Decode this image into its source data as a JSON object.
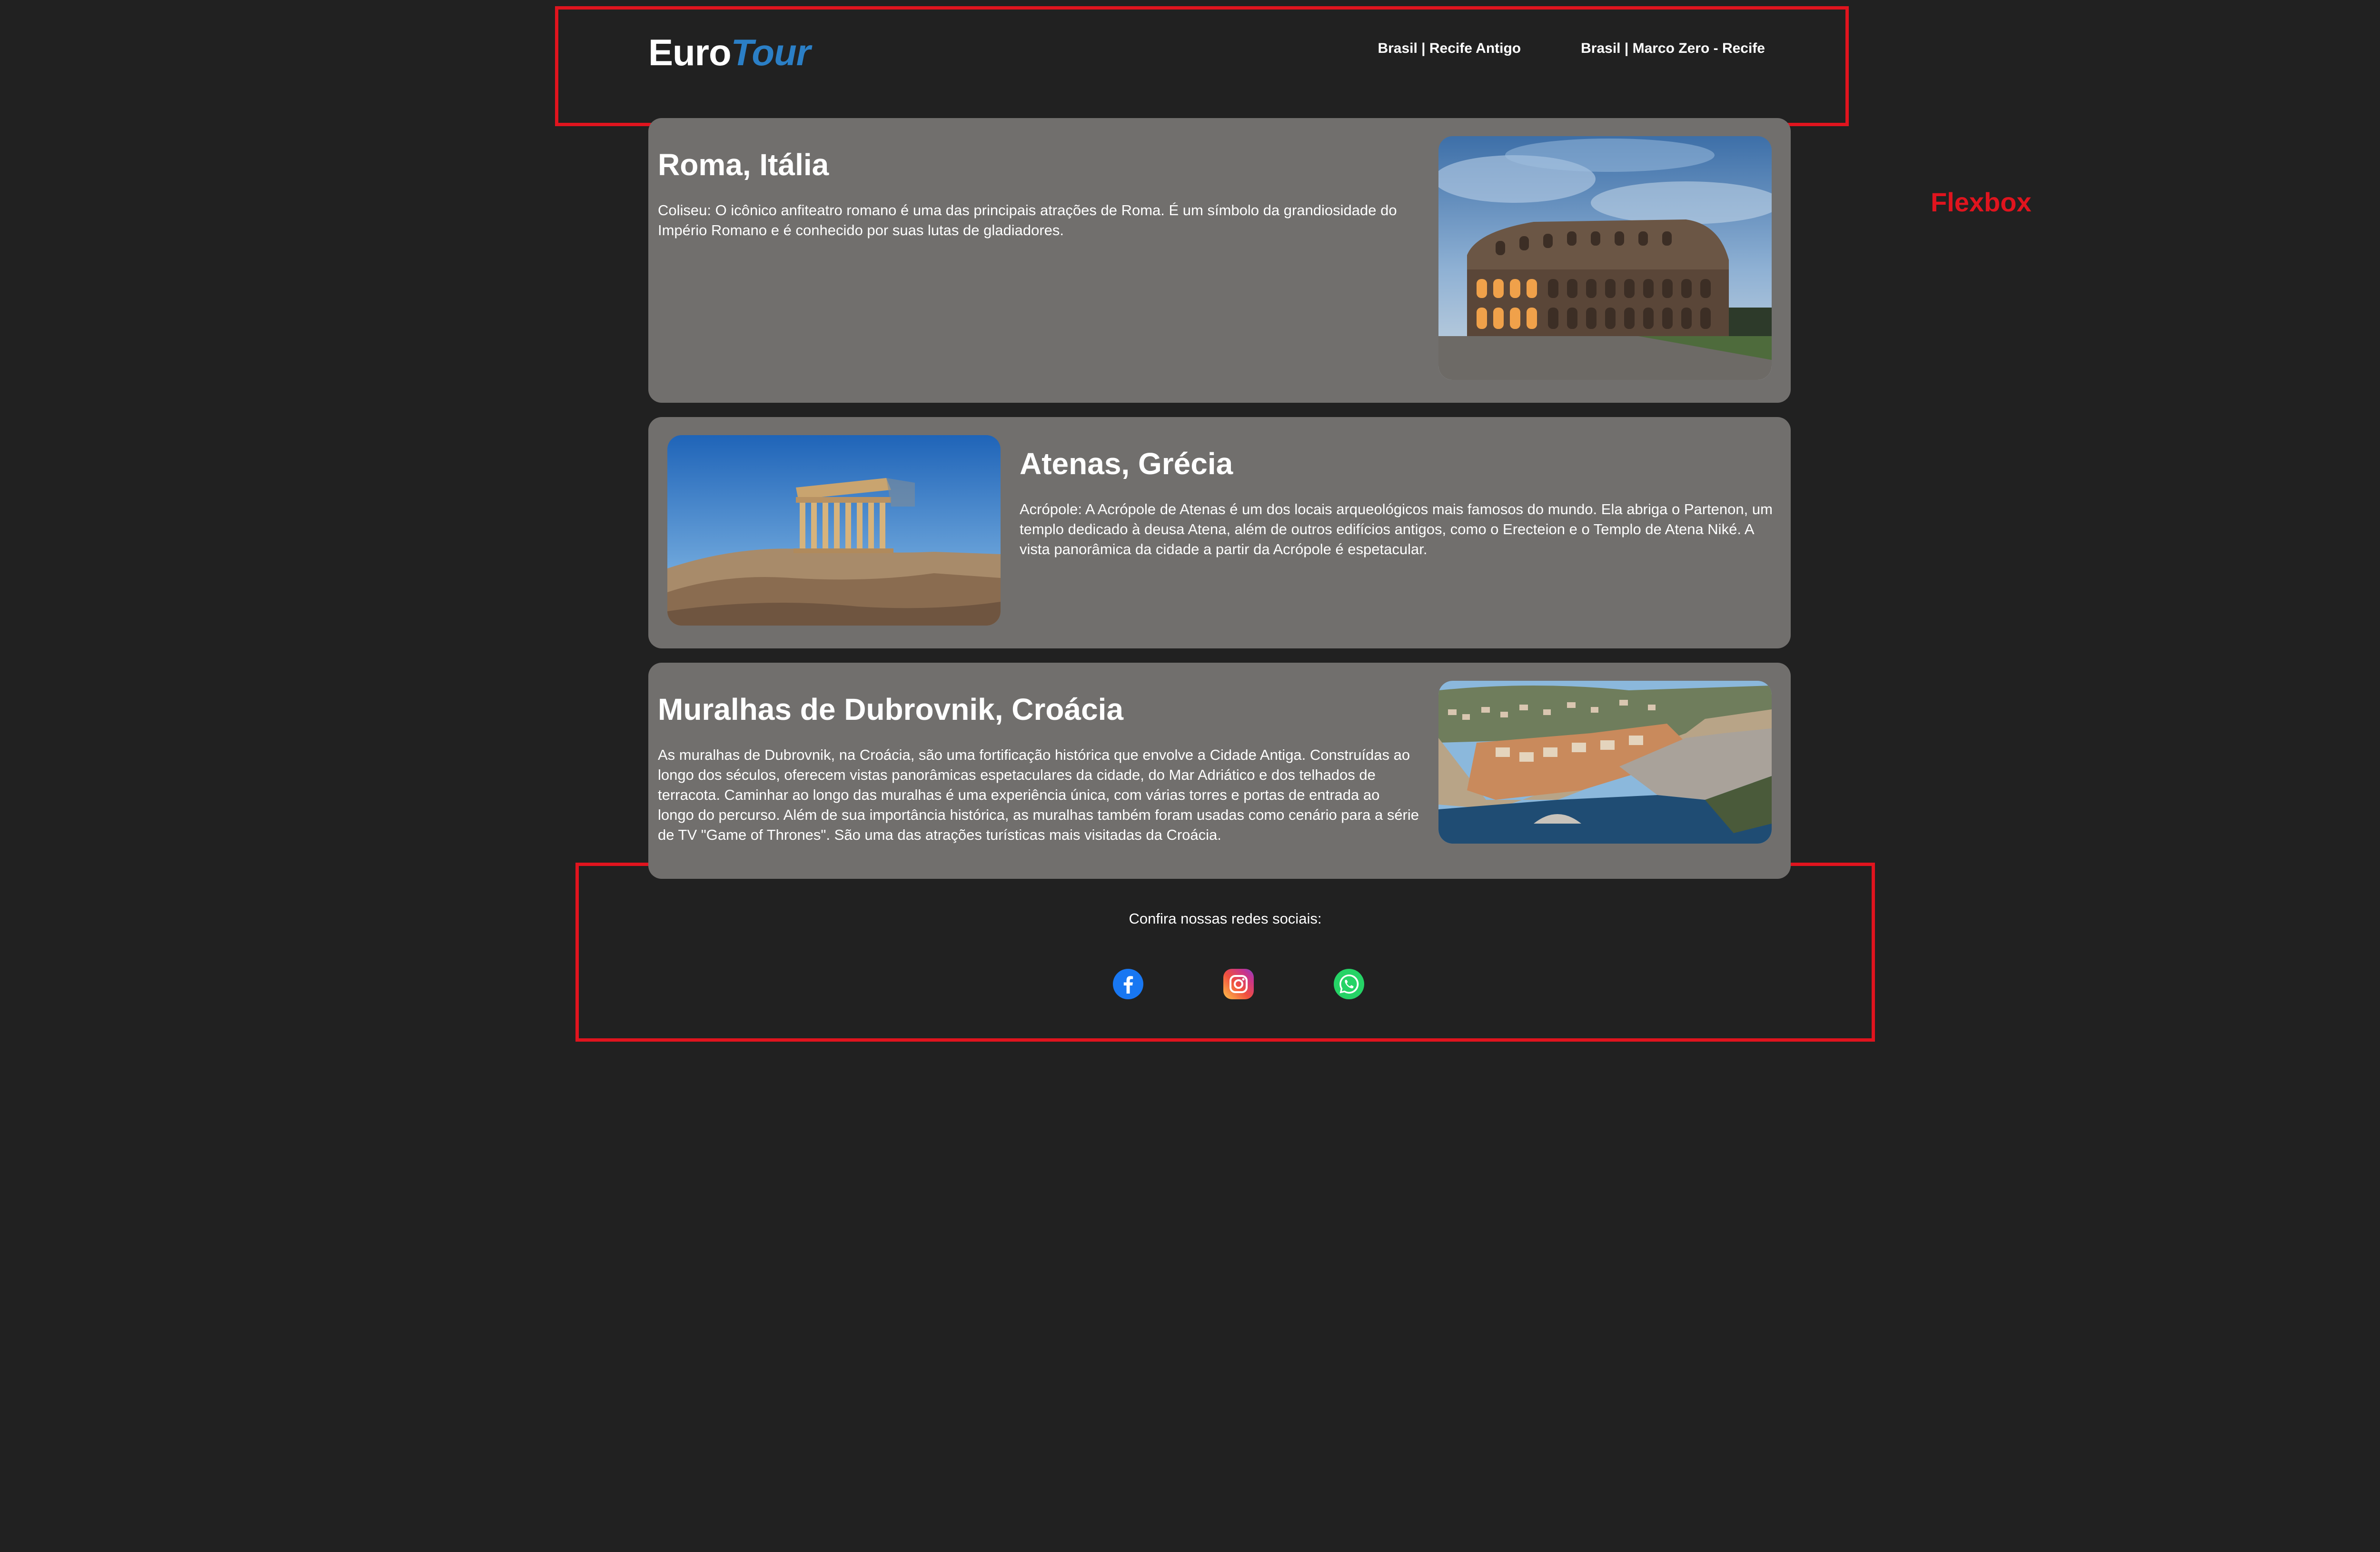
{
  "header": {
    "logo_main": "Euro",
    "logo_accent": "Tour",
    "nav": [
      {
        "label": "Brasil | Recife Antigo"
      },
      {
        "label": "Brasil | Marco Zero - Recife"
      }
    ]
  },
  "annotation": {
    "label": "Flexbox",
    "color": "#e0141e"
  },
  "cards": [
    {
      "title": "Roma, Itália",
      "description": "Coliseu: O icônico anfiteatro romano é uma das principais atrações de Roma. É um símbolo da grandiosidade do Império Romano e é conhecido por suas lutas de gladiadores.",
      "image": "colosseum-photo"
    },
    {
      "title": "Atenas, Grécia",
      "description": "Acrópole: A Acrópole de Atenas é um dos locais arqueológicos mais famosos do mundo. Ela abriga o Partenon, um templo dedicado à deusa Atena, além de outros edifícios antigos, como o Erecteion e o Templo de Atena Niké. A vista panorâmica da cidade a partir da Acrópole é espetacular.",
      "image": "parthenon-photo"
    },
    {
      "title": "Muralhas de Dubrovnik, Croácia",
      "description": "As muralhas de Dubrovnik, na Croácia, são uma fortificação histórica que envolve a Cidade Antiga. Construídas ao longo dos séculos, oferecem vistas panorâmicas espetaculares da cidade, do Mar Adriático e dos telhados de terracota. Caminhar ao longo das muralhas é uma experiência única, com várias torres e portas de entrada ao longo do percurso. Além de sua importância histórica, as muralhas também foram usadas como cenário para a série de TV \"Game of Thrones\". São uma das atrações turísticas mais visitadas da Croácia.",
      "image": "dubrovnik-photo"
    }
  ],
  "footer": {
    "text": "Confira nossas redes sociais:",
    "social": [
      {
        "name": "facebook-icon"
      },
      {
        "name": "instagram-icon"
      },
      {
        "name": "whatsapp-icon"
      }
    ]
  },
  "colors": {
    "background": "#212121",
    "card": "#716f6d",
    "logo_accent": "#2b7fc6"
  }
}
